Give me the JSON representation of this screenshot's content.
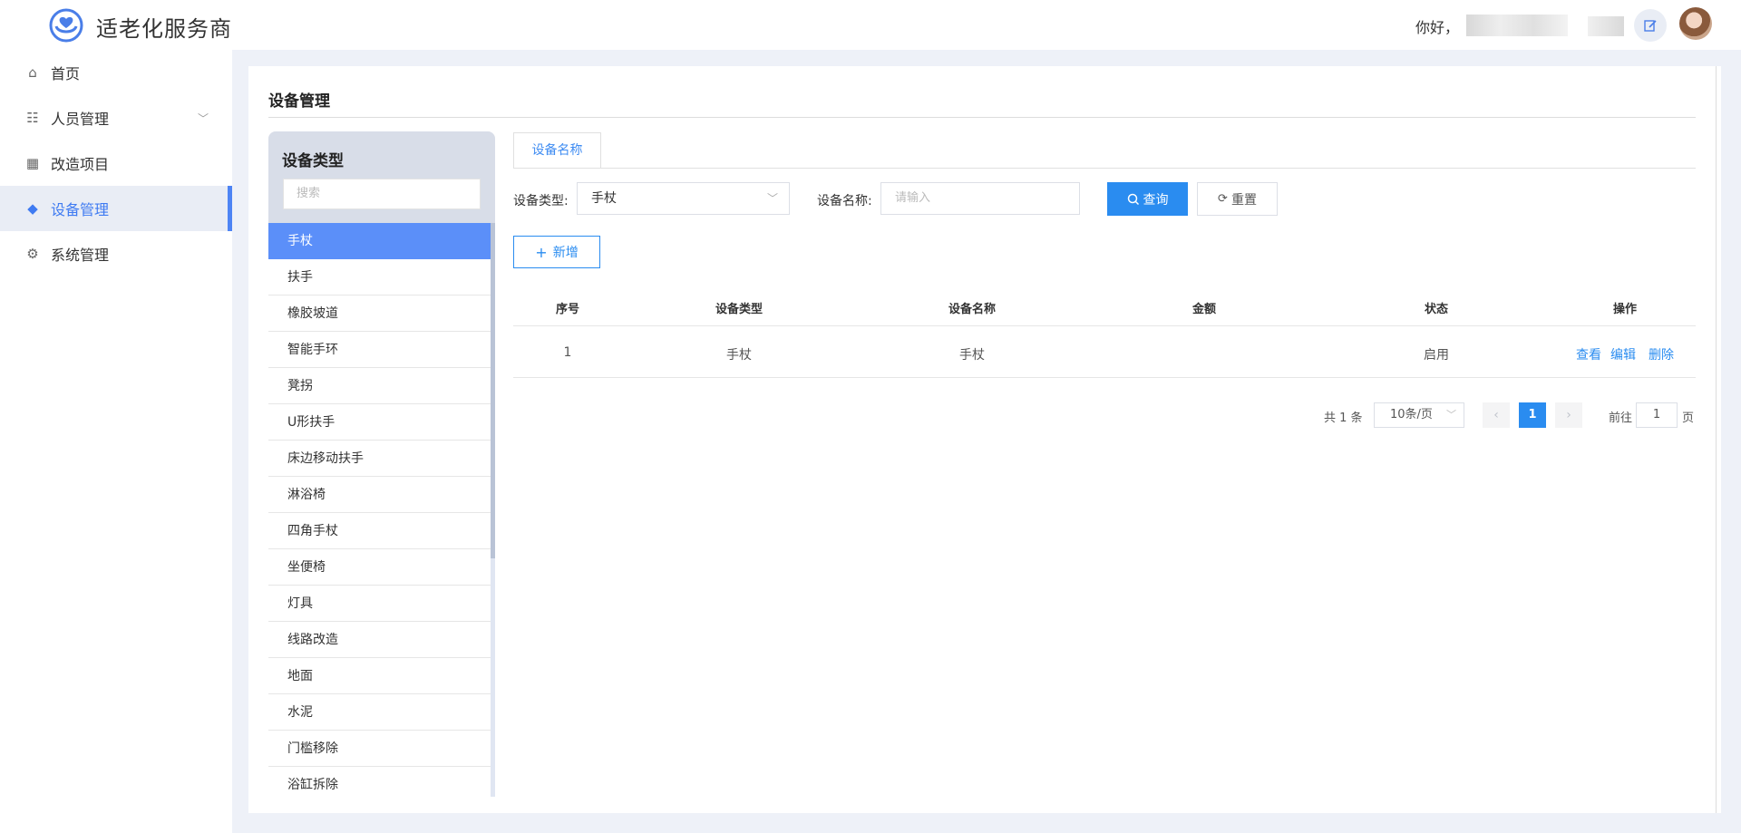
{
  "header": {
    "app_title": "适老化服务商",
    "greeting": "你好，",
    "logo_icon": "heart-hands-logo",
    "edit_icon": "edit-icon"
  },
  "sidebar": {
    "items": [
      {
        "label": "首页",
        "icon": "home-icon"
      },
      {
        "label": "人员管理",
        "icon": "people-icon"
      },
      {
        "label": "改造项目",
        "icon": "building-icon"
      },
      {
        "label": "设备管理",
        "icon": "cube-icon"
      },
      {
        "label": "系统管理",
        "icon": "gear-icon"
      }
    ],
    "active_index": 3
  },
  "page": {
    "title": "设备管理"
  },
  "type_panel": {
    "title": "设备类型",
    "search_placeholder": "搜索",
    "items": [
      "手杖",
      "扶手",
      "橡胶坡道",
      "智能手环",
      "凳拐",
      "U形扶手",
      "床边移动扶手",
      "淋浴椅",
      "四角手杖",
      "坐便椅",
      "灯具",
      "线路改造",
      "地面",
      "水泥",
      "门槛移除",
      "浴缸拆除"
    ],
    "active_index": 0
  },
  "tabs": [
    {
      "label": "设备名称"
    }
  ],
  "filters": {
    "type_label": "设备类型:",
    "type_value": "手杖",
    "name_label": "设备名称:",
    "name_placeholder": "请输入",
    "search_button": "查询",
    "reset_button": "重置",
    "add_button": "新增"
  },
  "table": {
    "headers": [
      "序号",
      "设备类型",
      "设备名称",
      "金额",
      "状态",
      "操作"
    ],
    "rows": [
      {
        "index": "1",
        "type": "手杖",
        "name": "手杖",
        "amount": "",
        "status": "启用",
        "actions": [
          "查看",
          "编辑",
          "删除"
        ]
      }
    ]
  },
  "pagination": {
    "total_text": "共 1 条",
    "page_size": "10条/页",
    "current_page": "1",
    "goto_label": "前往",
    "goto_value": "1",
    "goto_suffix": "页"
  },
  "colors": {
    "accent": "#2a8cf0",
    "active_item": "#5b8ff9",
    "sidebar_active_bg": "#e9edf5",
    "main_bg": "#eef1f8"
  }
}
